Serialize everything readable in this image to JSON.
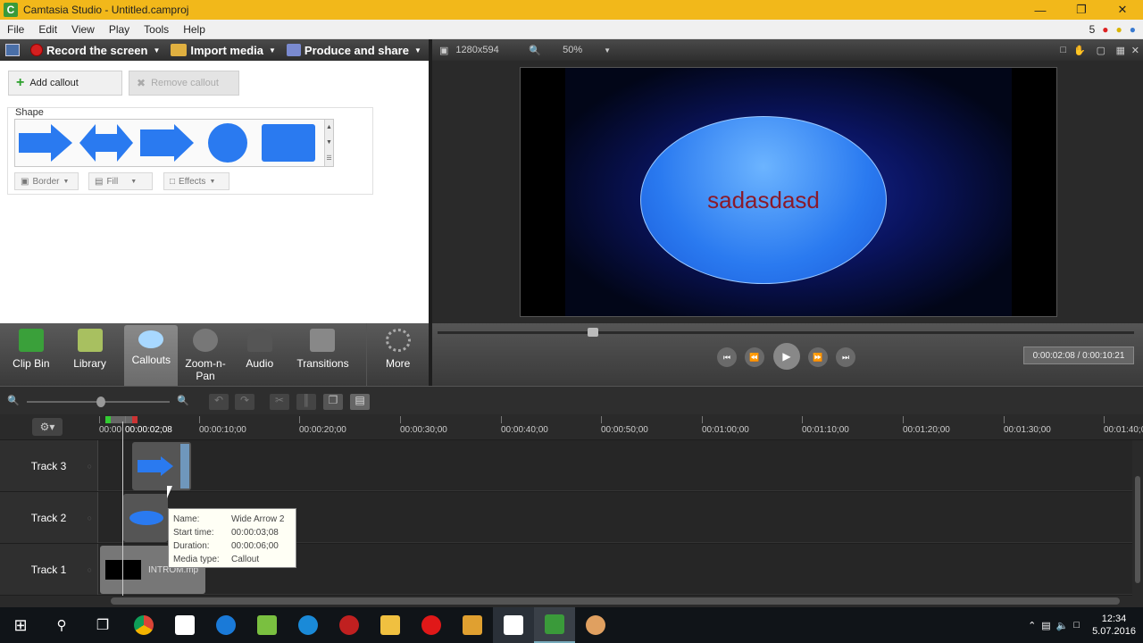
{
  "window": {
    "title": "Camtasia Studio - Untitled.camproj",
    "app_icon_letter": "C"
  },
  "menu": {
    "items": [
      "File",
      "Edit",
      "View",
      "Play",
      "Tools",
      "Help"
    ],
    "notification_count": "5"
  },
  "toolbar": {
    "record_label": "Record the screen",
    "import_label": "Import media",
    "produce_label": "Produce and share"
  },
  "callouts": {
    "add_label": "Add callout",
    "remove_label": "Remove callout",
    "shape_group_label": "Shape",
    "border_label": "Border",
    "fill_label": "Fill",
    "effects_label": "Effects"
  },
  "tasks": [
    {
      "label": "Clip Bin"
    },
    {
      "label": "Library"
    },
    {
      "label": "Callouts"
    },
    {
      "label": "Zoom-n-\nPan"
    },
    {
      "label": "Audio"
    },
    {
      "label": "Transitions"
    },
    {
      "label": "More"
    }
  ],
  "preview": {
    "dimensions": "1280x594",
    "zoom": "50%",
    "callout_text": "sadasdasd",
    "time_display": "0:00:02:08 / 0:00:10:21"
  },
  "timeline": {
    "ticks": [
      "00:00",
      "00:00:02;08",
      "00:00:10;00",
      "00:00:20;00",
      "00:00:30;00",
      "00:00:40;00",
      "00:00:50;00",
      "00:01:00;00",
      "00:01:10;00",
      "00:01:20;00",
      "00:01:30;00",
      "00:01:40;00"
    ],
    "tracks": [
      {
        "name": "Track 3"
      },
      {
        "name": "Track 2"
      },
      {
        "name": "Track 1"
      }
    ],
    "track1_clip_label": "INTROM.mp"
  },
  "tooltip": {
    "name_key": "Name:",
    "name_val": "Wide Arrow 2",
    "start_key": "Start time:",
    "start_val": "00:00:03;08",
    "duration_key": "Duration:",
    "duration_val": "00:00:06;00",
    "type_key": "Media type:",
    "type_val": "Callout"
  },
  "taskbar": {
    "time": "12:34",
    "date": "5.07.2016"
  },
  "colors": {
    "titlebar": "#f2b81a",
    "accent_blue": "#2a7af0",
    "callout_text": "#8a1a2a"
  }
}
